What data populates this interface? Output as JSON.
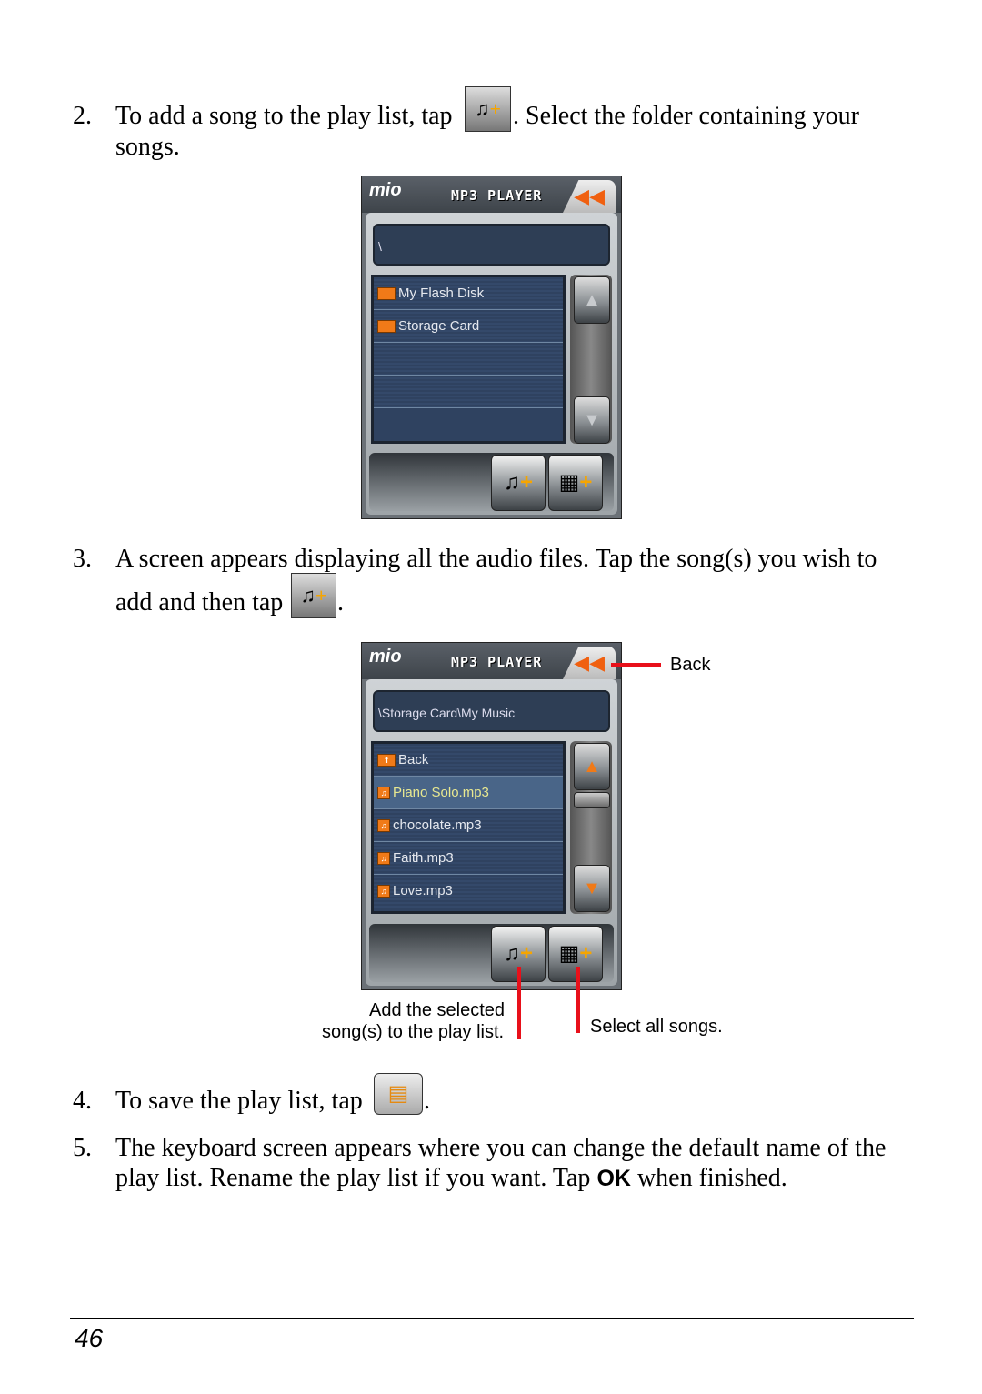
{
  "steps": [
    {
      "num": "2.",
      "line1_a": "To add a song to the play list, tap",
      "line1_b": ". Select the folder containing your",
      "line2": "songs."
    },
    {
      "num": "3.",
      "line1": "A screen appears displaying all the audio files. Tap the song(s) you wish to",
      "line2_a": "add and then tap",
      "line2_b": "."
    },
    {
      "num": "4.",
      "line1_a": "To save the play list, tap",
      "line1_b": "."
    },
    {
      "num": "5.",
      "line1": "The keyboard screen appears where you can change the default name of the",
      "line2_a": "play list. Rename the play list if you want. Tap ",
      "line2_ok": "OK",
      "line2_b": " when finished."
    }
  ],
  "screen1": {
    "logo": "mio",
    "title": "MP3 PLAYER",
    "path": "\\",
    "items": [
      "My Flash Disk",
      "Storage Card",
      "",
      ""
    ]
  },
  "screen2": {
    "logo": "mio",
    "title": "MP3 PLAYER",
    "path": "\\Storage Card\\My Music",
    "items": [
      "Back",
      "Piano Solo.mp3",
      "chocolate.mp3",
      "Faith.mp3",
      "Love.mp3"
    ],
    "selected": "Piano Solo.mp3"
  },
  "annotations": {
    "back": "Back",
    "add_line1": "Add the selected",
    "add_line2": "song(s) to the play list.",
    "select_all": "Select all songs."
  },
  "page_number": "46",
  "colors": {
    "annotation_line": "#e8101a",
    "list_bg": "#2f4260",
    "selected_text": "#e8e890",
    "accent": "#f07a18"
  }
}
